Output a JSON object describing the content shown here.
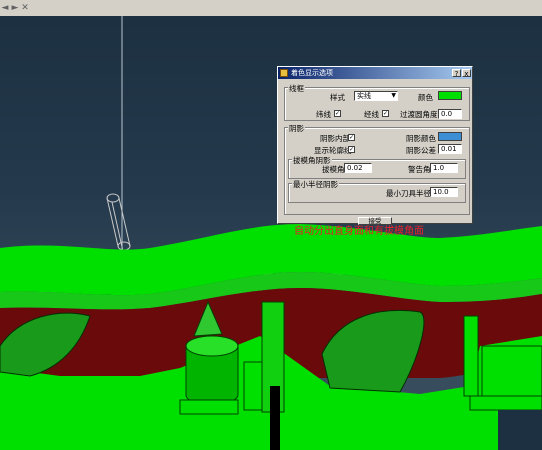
{
  "toolbar": {
    "icons": [
      "back-arrow-icon",
      "forward-arrow-icon",
      "close-icon"
    ],
    "glyphs": [
      "◄",
      "►",
      "✕"
    ]
  },
  "dialog": {
    "title": "着色显示选项",
    "help_label": "?",
    "close_label": "x",
    "wireframe": {
      "title": "线框",
      "style_label": "样式",
      "style_value": "实线",
      "color_label": "颜色",
      "color": "#00e000",
      "lat_label": "纬线",
      "lat_checked": true,
      "lon_label": "经线",
      "lon_checked": true,
      "transition_label": "过渡圆角度",
      "transition_value": "0.0"
    },
    "shading": {
      "title": "阴影",
      "inner_label": "阴影内部",
      "inner_checked": true,
      "shade_color_label": "阴影颜色",
      "shade_color": "#3c8fd4",
      "outline_label": "显示轮廓线",
      "outline_checked": true,
      "tolerance_label": "阴影公差",
      "tolerance_value": "0.01"
    },
    "draft": {
      "title": "拔模角阴影",
      "draft_angle_label": "拔模角",
      "draft_angle_value": "0.02",
      "warn_angle_label": "警告角",
      "warn_angle_value": "1.0"
    },
    "radius": {
      "title": "最小半径阴影",
      "min_radius_label": "最小刀具半径",
      "min_radius_value": "10.0"
    },
    "ok_label": "接受"
  },
  "annotation": {
    "text": "自动分出直身面和有拔模角面",
    "color": "#e8212b"
  },
  "scene": {
    "background": "#2a4050",
    "green": "#00e000",
    "dark_red": "#6b0a0a",
    "crosshair": "#b8c4d0"
  }
}
